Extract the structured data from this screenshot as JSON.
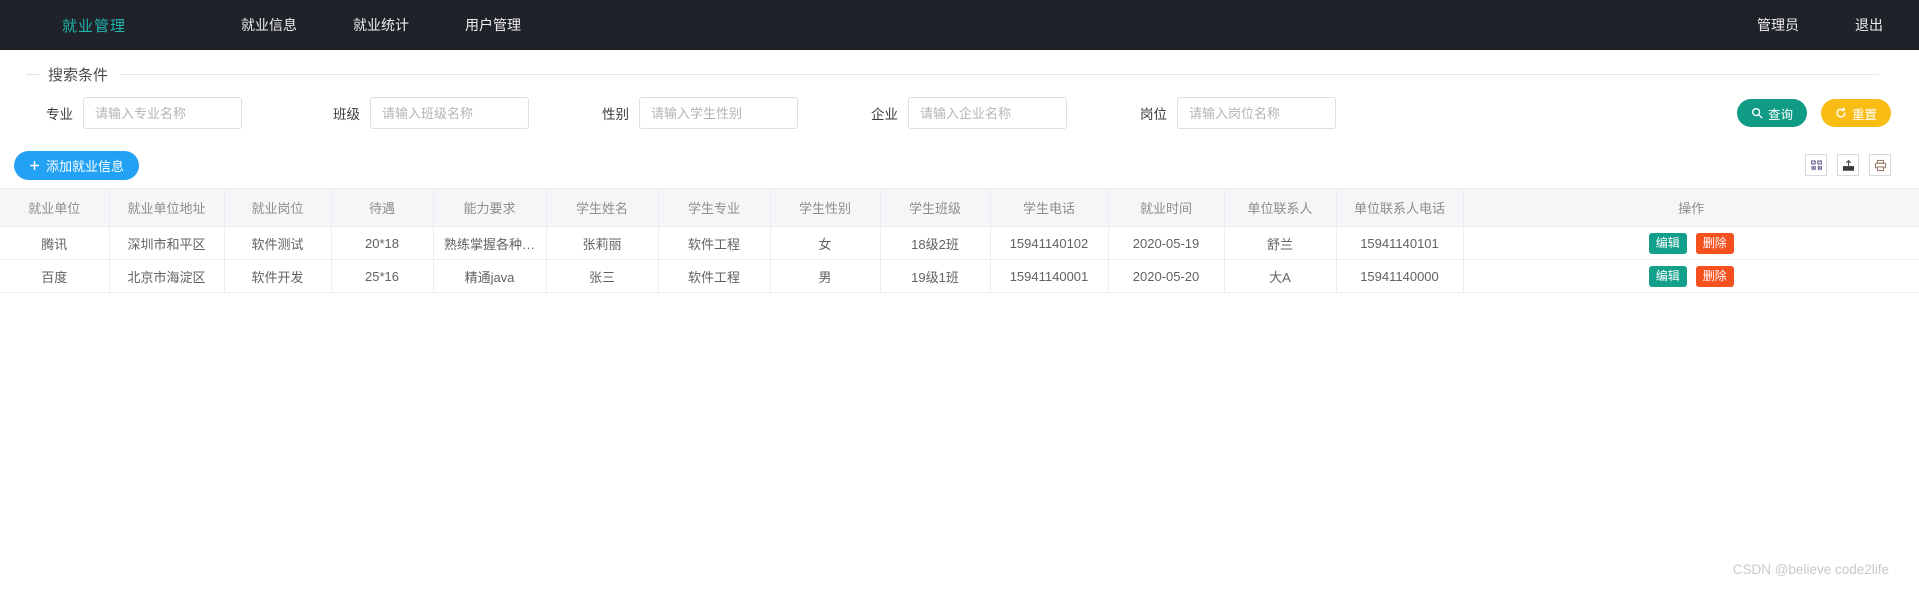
{
  "navbar": {
    "brand": "就业管理",
    "links": [
      "就业信息",
      "就业统计",
      "用户管理"
    ],
    "right": [
      "管理员",
      "退出"
    ]
  },
  "search_panel": {
    "legend": "搜索条件",
    "fields": [
      {
        "label": "专业",
        "placeholder": "请输入专业名称",
        "value": ""
      },
      {
        "label": "班级",
        "placeholder": "请输入班级名称",
        "value": ""
      },
      {
        "label": "性别",
        "placeholder": "请输入学生性别",
        "value": ""
      },
      {
        "label": "企业",
        "placeholder": "请输入企业名称",
        "value": ""
      },
      {
        "label": "岗位",
        "placeholder": "请输入岗位名称",
        "value": ""
      }
    ],
    "search_button": {
      "label": "查询",
      "icon": "search-icon",
      "color": "#0f9b84"
    },
    "reset_button": {
      "label": "重置",
      "icon": "refresh-icon",
      "color": "#f9bc14"
    }
  },
  "action_bar": {
    "add_button": {
      "label": "添加就业信息",
      "icon": "plus-icon",
      "color": "#22a1f5"
    },
    "tool_icons": [
      "columns-icon",
      "export-icon",
      "print-icon"
    ]
  },
  "table": {
    "columns": [
      "就业单位",
      "就业单位地址",
      "就业岗位",
      "待遇",
      "能力要求",
      "学生姓名",
      "学生专业",
      "学生性别",
      "学生班级",
      "学生电话",
      "就业时间",
      "单位联系人",
      "单位联系人电话",
      "操作"
    ],
    "rows": [
      {
        "company": "腾讯",
        "address": "深圳市和平区",
        "position": "软件测试",
        "salary": "20*18",
        "requirement": "熟练掌握各种…",
        "student_name": "张莉丽",
        "student_major": "软件工程",
        "student_gender": "女",
        "student_class": "18级2班",
        "student_phone": "15941140102",
        "employ_date": "2020-05-19",
        "contact": "舒兰",
        "contact_phone": "15941140101",
        "edit_label": "编辑",
        "delete_label": "删除"
      },
      {
        "company": "百度",
        "address": "北京市海淀区",
        "position": "软件开发",
        "salary": "25*16",
        "requirement": "精通java",
        "student_name": "张三",
        "student_major": "软件工程",
        "student_gender": "男",
        "student_class": "19级1班",
        "student_phone": "15941140001",
        "employ_date": "2020-05-20",
        "contact": "大A",
        "contact_phone": "15941140000",
        "edit_label": "编辑",
        "delete_label": "删除"
      }
    ]
  },
  "watermark": "CSDN @believe code2life"
}
